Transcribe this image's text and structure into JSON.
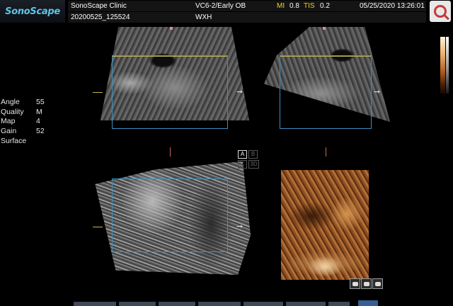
{
  "header": {
    "logo": "SonoScape",
    "clinic": "SonoScape Clinic",
    "patient_id": "20200525_125524",
    "probe_preset": "VC6-2/Early OB",
    "patient_name": "WXH",
    "mi_label": "MI",
    "mi_value": "0.8",
    "tis_label": "TIS",
    "tis_value": "0.2",
    "datetime": "05/25/2020 13:26:01",
    "zoom_icon": "magnifier-icon"
  },
  "params": [
    {
      "label": "Angle",
      "value": "55"
    },
    {
      "label": "Quality",
      "value": "M"
    },
    {
      "label": "Map",
      "value": "4"
    },
    {
      "label": "Gain",
      "value": "52"
    },
    {
      "label": "Surface",
      "value": ""
    }
  ],
  "view_buttons": {
    "a": "A",
    "b": "B",
    "c": "C",
    "three_d": "3D",
    "active": "A"
  },
  "colors": {
    "accent_yellow": "#f4d21e",
    "roi_blue": "#3e8ec0",
    "marker_yellow": "#c8b44a"
  },
  "tools": [
    "3d-render-icon",
    "transfer-icon",
    "print-icon"
  ]
}
